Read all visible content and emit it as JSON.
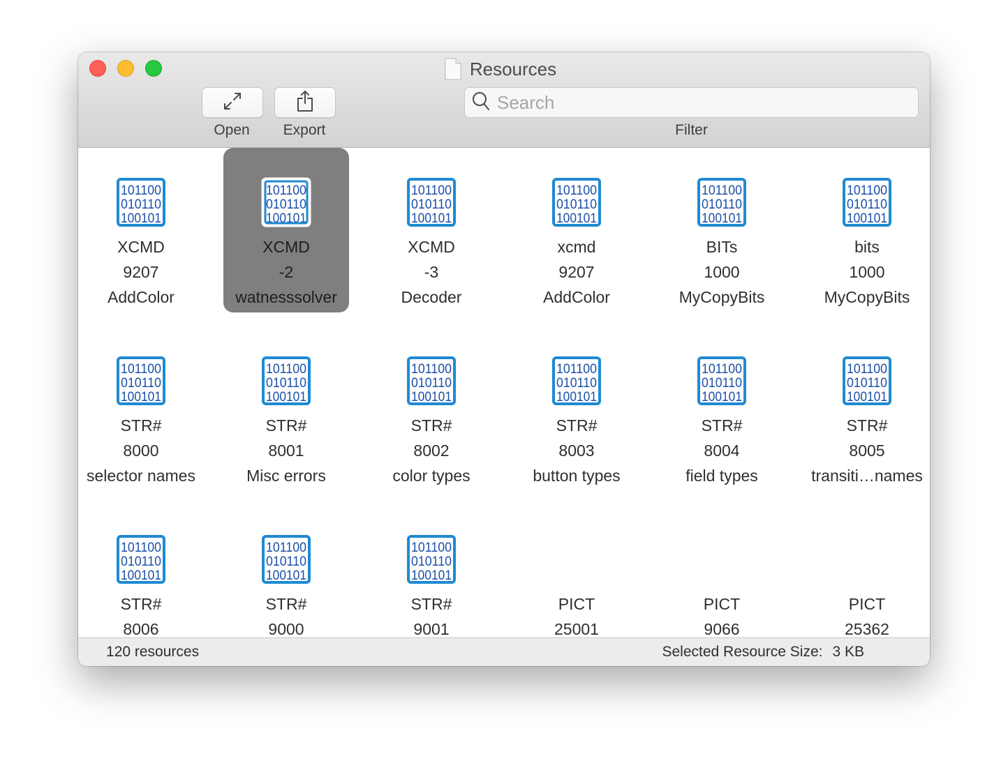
{
  "window": {
    "title": "Resources",
    "title_icon": "document-icon"
  },
  "toolbar": {
    "open_label": "Open",
    "open_icon": "expand-arrows-icon",
    "export_label": "Export",
    "export_icon": "share-icon",
    "search_placeholder": "Search",
    "search_value": "",
    "filter_label": "Filter"
  },
  "colors": {
    "icon_blue": "#1f8ad2",
    "icon_text_blue": "#1b4fa8",
    "selection": "#7f7f7f",
    "close": "#fe5f57",
    "minimize": "#febc2e",
    "maximize": "#28c840"
  },
  "icon_binary_lines": [
    "101100",
    "010110",
    "100101"
  ],
  "resources": [
    {
      "type": "XCMD",
      "id": "9207",
      "name": "AddColor",
      "icon": "binary-data-icon",
      "selected": false
    },
    {
      "type": "XCMD",
      "id": "-2",
      "name": "watnesssolver",
      "icon": "binary-data-icon",
      "selected": true
    },
    {
      "type": "XCMD",
      "id": "-3",
      "name": "Decoder",
      "icon": "binary-data-icon",
      "selected": false
    },
    {
      "type": "xcmd",
      "id": "9207",
      "name": "AddColor",
      "icon": "binary-data-icon",
      "selected": false
    },
    {
      "type": "BITs",
      "id": "1000",
      "name": "MyCopyBits",
      "icon": "binary-data-icon",
      "selected": false
    },
    {
      "type": "bits",
      "id": "1000",
      "name": "MyCopyBits",
      "icon": "binary-data-icon",
      "selected": false
    },
    {
      "type": "STR#",
      "id": "8000",
      "name": "selector names",
      "icon": "binary-data-icon",
      "selected": false
    },
    {
      "type": "STR#",
      "id": "8001",
      "name": "Misc errors",
      "icon": "binary-data-icon",
      "selected": false
    },
    {
      "type": "STR#",
      "id": "8002",
      "name": "color types",
      "icon": "binary-data-icon",
      "selected": false
    },
    {
      "type": "STR#",
      "id": "8003",
      "name": "button types",
      "icon": "binary-data-icon",
      "selected": false
    },
    {
      "type": "STR#",
      "id": "8004",
      "name": "field types",
      "icon": "binary-data-icon",
      "selected": false
    },
    {
      "type": "STR#",
      "id": "8005",
      "name": "transiti…names",
      "icon": "binary-data-icon",
      "selected": false
    },
    {
      "type": "STR#",
      "id": "8006",
      "name": "",
      "icon": "binary-data-icon",
      "selected": false
    },
    {
      "type": "STR#",
      "id": "9000",
      "name": "",
      "icon": "binary-data-icon",
      "selected": false
    },
    {
      "type": "STR#",
      "id": "9001",
      "name": "",
      "icon": "binary-data-icon",
      "selected": false
    },
    {
      "type": "PICT",
      "id": "25001",
      "name": "",
      "icon": "",
      "selected": false
    },
    {
      "type": "PICT",
      "id": "9066",
      "name": "",
      "icon": "",
      "selected": false
    },
    {
      "type": "PICT",
      "id": "25362",
      "name": "",
      "icon": "",
      "selected": false
    }
  ],
  "status": {
    "count_text": "120 resources",
    "selected_size_label": "Selected Resource Size:",
    "selected_size_value": "3 KB"
  }
}
